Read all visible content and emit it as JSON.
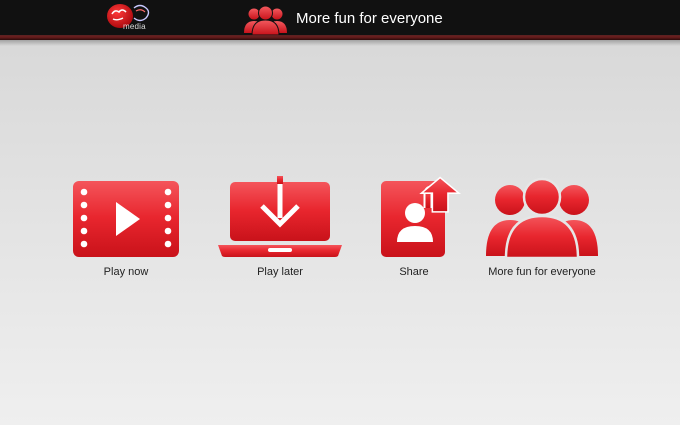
{
  "header": {
    "logo": {
      "brand_wordmark": "Virgin",
      "sub_label": "media",
      "brand_color": "#d40e14"
    },
    "title": "More fun for everyone",
    "title_icon": "group-people-icon"
  },
  "menu": {
    "items": [
      {
        "label": "Play now",
        "icon": "video-play-icon"
      },
      {
        "label": "Play later",
        "icon": "laptop-download-icon"
      },
      {
        "label": "Share",
        "icon": "share-upload-icon"
      },
      {
        "label": "More fun for everyone",
        "icon": "group-people-icon"
      }
    ]
  },
  "colors": {
    "accent": "#e41b23",
    "accent_light": "#f2545a",
    "topbar": "#111111",
    "background": "#dedede"
  }
}
